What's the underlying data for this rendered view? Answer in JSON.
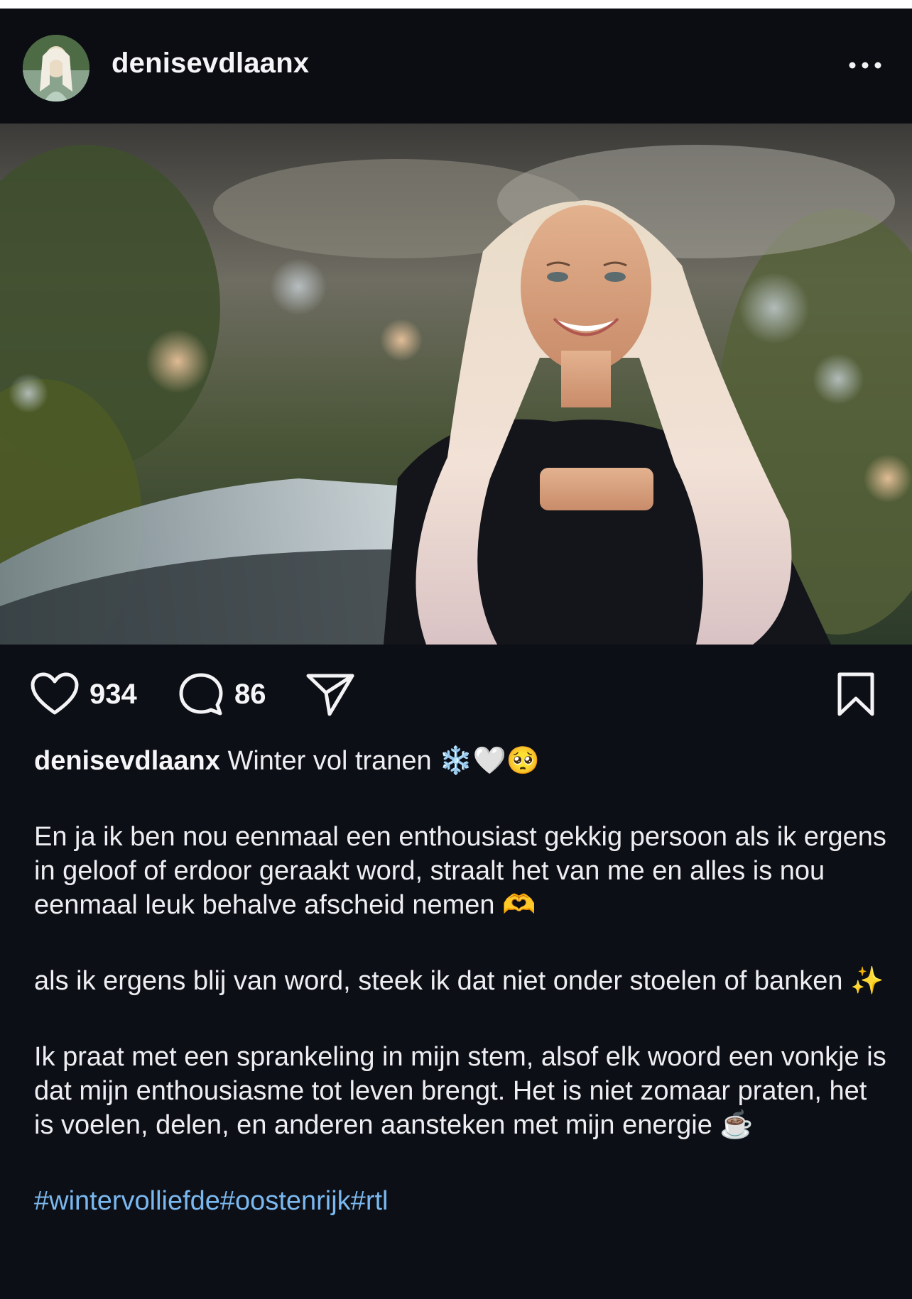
{
  "post": {
    "username": "denisevdlaanx",
    "more_icon": "more-horizontal-icon",
    "photo_alt": "",
    "likes": "934",
    "comments": "86",
    "caption_title": "Winter vol tranen ❄️🤍🥺",
    "paragraphs": [
      "En ja ik ben nou eenmaal een enthousiast gekkig persoon als ik ergens in geloof of erdoor geraakt word, straalt het van me en alles is nou eenmaal leuk behalve afscheid nemen 🫶",
      "als ik ergens blij van word, steek ik dat niet onder stoelen of banken ✨",
      "Ik praat met een sprankeling in mijn stem, alsof elk woord een vonkje is dat mijn enthousiasme tot leven brengt. Het is niet zomaar praten, het is voelen, delen, en anderen aansteken met mijn energie ☕"
    ],
    "hashtags": "#wintervolliefde#oostenrijk#rtl"
  },
  "colors": {
    "background": "#0d0f16",
    "header": "#0b0d13",
    "text": "#f4f4f6",
    "hashtag": "#7ab8ef"
  },
  "icons": {
    "like": "heart-icon",
    "comment": "comment-bubble-icon",
    "share": "paper-plane-icon",
    "save": "bookmark-icon"
  }
}
